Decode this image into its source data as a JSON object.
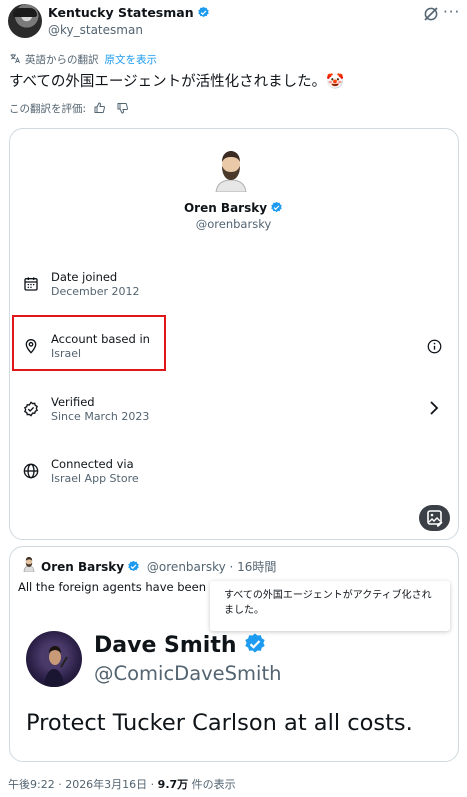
{
  "post": {
    "author_name": "Kentucky Statesman",
    "author_handle": "@ky_statesman",
    "translation_note": "英語からの翻訳",
    "show_original": "原文を表示",
    "translated_text": "すべての外国エージェントが活性化されました。🤡",
    "rate_translation": "この翻訳を評価:"
  },
  "profile_card": {
    "name": "Oren Barsky",
    "handle": "@orenbarsky",
    "rows": [
      {
        "title": "Date joined",
        "value": "December 2012",
        "icon": "calendar-icon"
      },
      {
        "title": "Account based in",
        "value": "Israel",
        "icon": "location-pin-icon"
      },
      {
        "title": "Verified",
        "value": "Since March 2023",
        "icon": "verified-badge-outline-icon"
      },
      {
        "title": "Connected via",
        "value": "Israel App Store",
        "icon": "globe-icon"
      }
    ]
  },
  "quoted": {
    "name": "Oren Barsky",
    "handle_time": "@orenbarsky · 16時間",
    "body": "All the foreign agents have been activated.",
    "tooltip": "すべての外国エージェントがアクティブ化されました。",
    "image": {
      "name": "Dave Smith",
      "handle": "@ComicDaveSmith",
      "text": "Protect Tucker Carlson at all costs."
    }
  },
  "footer": {
    "time_date": "午後9:22 · 2026年3月16日 · ",
    "views_count": "9.7万",
    "views_label": " 件の表示"
  },
  "colors": {
    "accent": "#1d9bf0",
    "highlight": "#e0161b",
    "text": "#0f1419",
    "muted": "#536471",
    "border": "#cfd9de"
  }
}
